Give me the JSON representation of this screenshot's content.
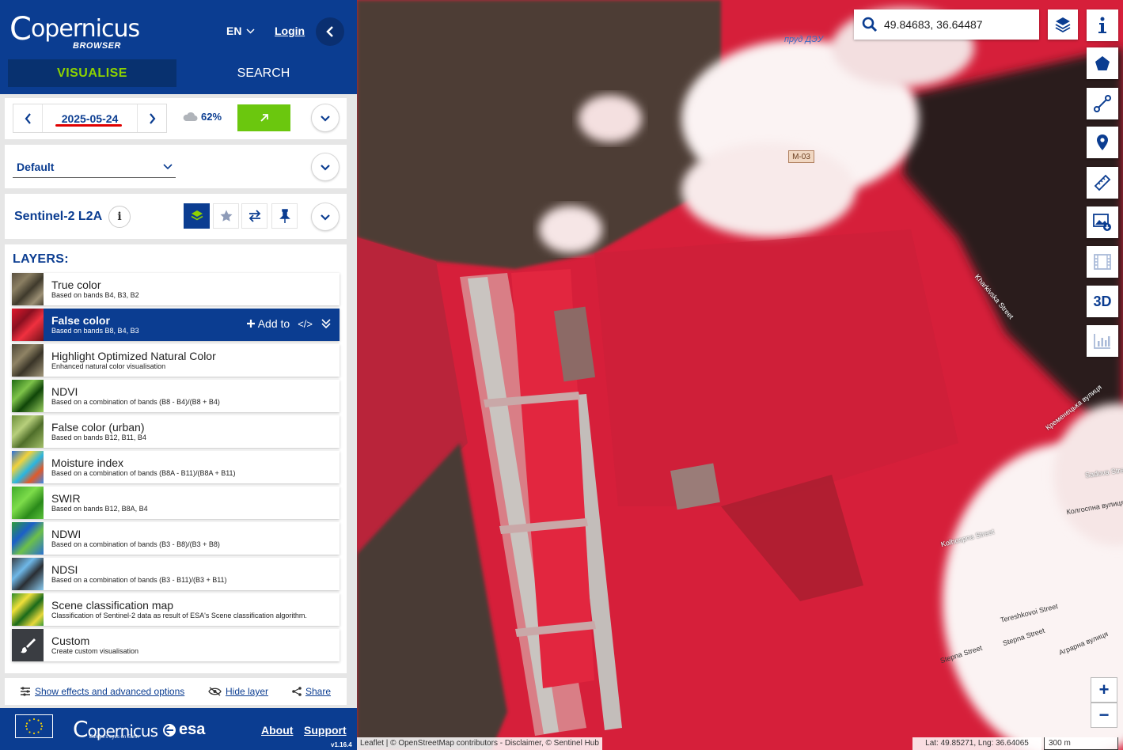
{
  "header": {
    "logo_text": "opernicus",
    "logo_c": "C",
    "logo_sub": "BROWSER",
    "lang": "EN",
    "login": "Login",
    "tabs": {
      "visualise": "VISUALISE",
      "search": "SEARCH"
    }
  },
  "date": {
    "value": "2025-05-24",
    "cloud_coverage": "62%"
  },
  "theme": {
    "selected": "Default"
  },
  "collection": {
    "title": "Sentinel-2 L2A",
    "info": "i"
  },
  "layers": {
    "title": "LAYERS:",
    "add_to": "Add to",
    "embed": "</>",
    "items": [
      {
        "name": "True color",
        "desc": "Based on bands B4, B3, B2"
      },
      {
        "name": "False color",
        "desc": "Based on bands B8, B4, B3"
      },
      {
        "name": "Highlight Optimized Natural Color",
        "desc": "Enhanced natural color visualisation"
      },
      {
        "name": "NDVI",
        "desc": "Based on a combination of bands (B8 - B4)/(B8 + B4)"
      },
      {
        "name": "False color (urban)",
        "desc": "Based on bands B12, B11, B4"
      },
      {
        "name": "Moisture index",
        "desc": "Based on a combination of bands (B8A - B11)/(B8A + B11)"
      },
      {
        "name": "SWIR",
        "desc": "Based on bands B12, B8A, B4"
      },
      {
        "name": "NDWI",
        "desc": "Based on a combination of bands (B3 - B8)/(B3 + B8)"
      },
      {
        "name": "NDSI",
        "desc": "Based on a combination of bands (B3 - B11)/(B3 + B11)"
      },
      {
        "name": "Scene classification map",
        "desc": "Classification of Sentinel-2 data as result of ESA's Scene classification algorithm."
      },
      {
        "name": "Custom",
        "desc": "Create custom visualisation"
      }
    ]
  },
  "footer_links": {
    "effects": "Show effects and advanced options",
    "hide": "Hide layer",
    "share": "Share"
  },
  "bottom": {
    "copernicus": "opernicus",
    "copernicus_c": "C",
    "copernicus_sub": "Europe's eyes on Earth",
    "esa": "esa",
    "about": "About",
    "support": "Support",
    "version": "v1.16.4"
  },
  "map": {
    "search_value": "49.84683, 36.64487",
    "three_d": "3D",
    "zoom_in": "+",
    "zoom_out": "−",
    "attribution": "Leaflet | © OpenStreetMap contributors - Disclaimer, © Sentinel Hub",
    "latlng": "Lat: 49.85271, Lng: 36.64065",
    "scale": "300 m",
    "road_badge": "M-03",
    "labels": {
      "pond": "пруд ДЭУ",
      "kharkivska": "Kharkivska Street",
      "kreminets": "Кременецька вулиця",
      "sadova": "Sadova Stree",
      "kolhospna_ua": "Колгоспна вулиця",
      "kolhospna": "Kolhospna Street",
      "tereshkovoi": "Tereshkovoi Street",
      "stepna": "Stepna Street",
      "stepna2": "Stepna Street",
      "ahrarna": "Аграрна вулиця"
    }
  },
  "colors": {
    "brand_blue": "#0b3d91",
    "accent_green": "#6bc70e",
    "vis_tab_text": "#8dd300",
    "false_color_red": "#d4203c"
  }
}
